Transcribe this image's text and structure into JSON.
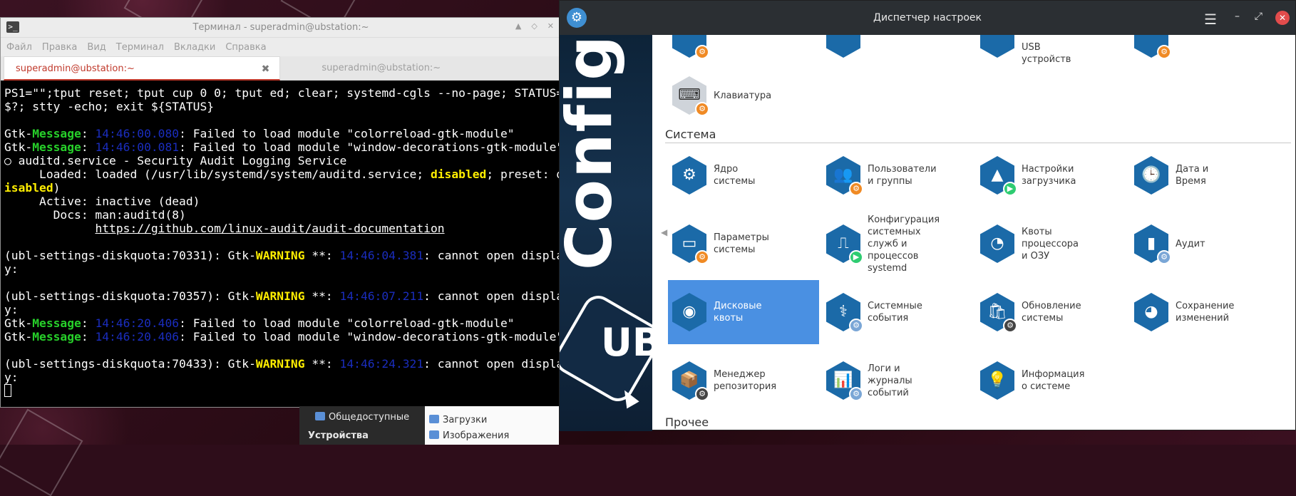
{
  "terminal": {
    "icon": "terminal-icon",
    "title": "Терминал - superadmin@ubstation:~",
    "menu": [
      "Файл",
      "Правка",
      "Вид",
      "Терминал",
      "Вкладки",
      "Справка"
    ],
    "tabs": [
      {
        "label": "superadmin@ubstation:~",
        "active": true
      },
      {
        "label": "superadmin@ubstation:~",
        "active": false
      }
    ],
    "lines": {
      "l1": "PS1=\"\";tput reset; tput cup 0 0; tput ed; clear; systemd-cgls --no-page; STATUS=",
      "l2": "$?; stty -echo; exit ${STATUS}",
      "gtk": "Gtk-",
      "message": "Message",
      "warning": "WARNING",
      "t1": "14:46:00.080",
      "t2": "14:46:00.081",
      "t3": "14:46:04.381",
      "t4": "14:46:07.211",
      "t5": "14:46:20.406",
      "t6": "14:46:20.406",
      "t7": "14:46:24.321",
      "m1": ": Failed to load module \"colorreload-gtk-module\"",
      "m2": ": Failed to load module \"window-decorations-gtk-module\"",
      "aud1": "○ auditd.service - Security Audit Logging Service",
      "aud2a": "     Loaded: loaded (/usr/lib/systemd/system/auditd.service; ",
      "disabled": "disabled",
      "aud2b": "; preset: d",
      "aud3a": "isabled",
      "aud3b": ")",
      "aud4": "     Active: inactive (dead)",
      "aud5": "       Docs: man:auditd(8)",
      "aud6pre": "             ",
      "aud6": "https://github.com/linux-audit/audit-documentation",
      "w1": "(ubl-settings-diskquota:70331): ",
      "w2": "(ubl-settings-diskquota:70357): ",
      "w3": "(ubl-settings-diskquota:70433): ",
      "wsep": " **: ",
      "wmsg": ": cannot open displa",
      "y": "y:"
    }
  },
  "settings": {
    "title": "Диспетчер настроек",
    "icons": {
      "app": "gear-icon",
      "menu": "hamburger-icon",
      "minimize": "minimize-icon",
      "maximize": "maximize-icon",
      "close": "close-icon"
    },
    "banner": "Config",
    "banner_ub": "UB",
    "top_partial": "USB устройств",
    "keyboard": "Клавиатура",
    "section_system": "Система",
    "section_other": "Прочее",
    "tiles": [
      {
        "label": "Ядро системы",
        "icon": "kernel-gear-icon"
      },
      {
        "label": "Пользователи и группы",
        "icon": "users-icon"
      },
      {
        "label": "Настройки загрузчика",
        "icon": "bootloader-icon"
      },
      {
        "label": "Дата и Время",
        "icon": "clock-icon"
      },
      {
        "label": "Параметры системы",
        "icon": "system-params-icon"
      },
      {
        "label": "Конфигурация системных служб и процессов systemd",
        "icon": "services-icon"
      },
      {
        "label": "Квоты процессора и ОЗУ",
        "icon": "cpu-quota-icon"
      },
      {
        "label": "Аудит",
        "icon": "audit-icon"
      },
      {
        "label": "Дисковые квоты",
        "icon": "disk-quota-icon",
        "selected": true
      },
      {
        "label": "Системные события",
        "icon": "events-icon"
      },
      {
        "label": "Обновление системы",
        "icon": "update-icon"
      },
      {
        "label": "Сохранение изменений",
        "icon": "save-icon"
      },
      {
        "label": "Менеджер репозитория",
        "icon": "repo-icon"
      },
      {
        "label": "Логи и журналы событий",
        "icon": "logs-icon"
      },
      {
        "label": "Информация о системе",
        "icon": "info-icon"
      }
    ]
  },
  "file_manager": {
    "public": "Общедоступные",
    "devices": "Устройства",
    "downloads": "Загрузки",
    "images": "Изображения"
  }
}
